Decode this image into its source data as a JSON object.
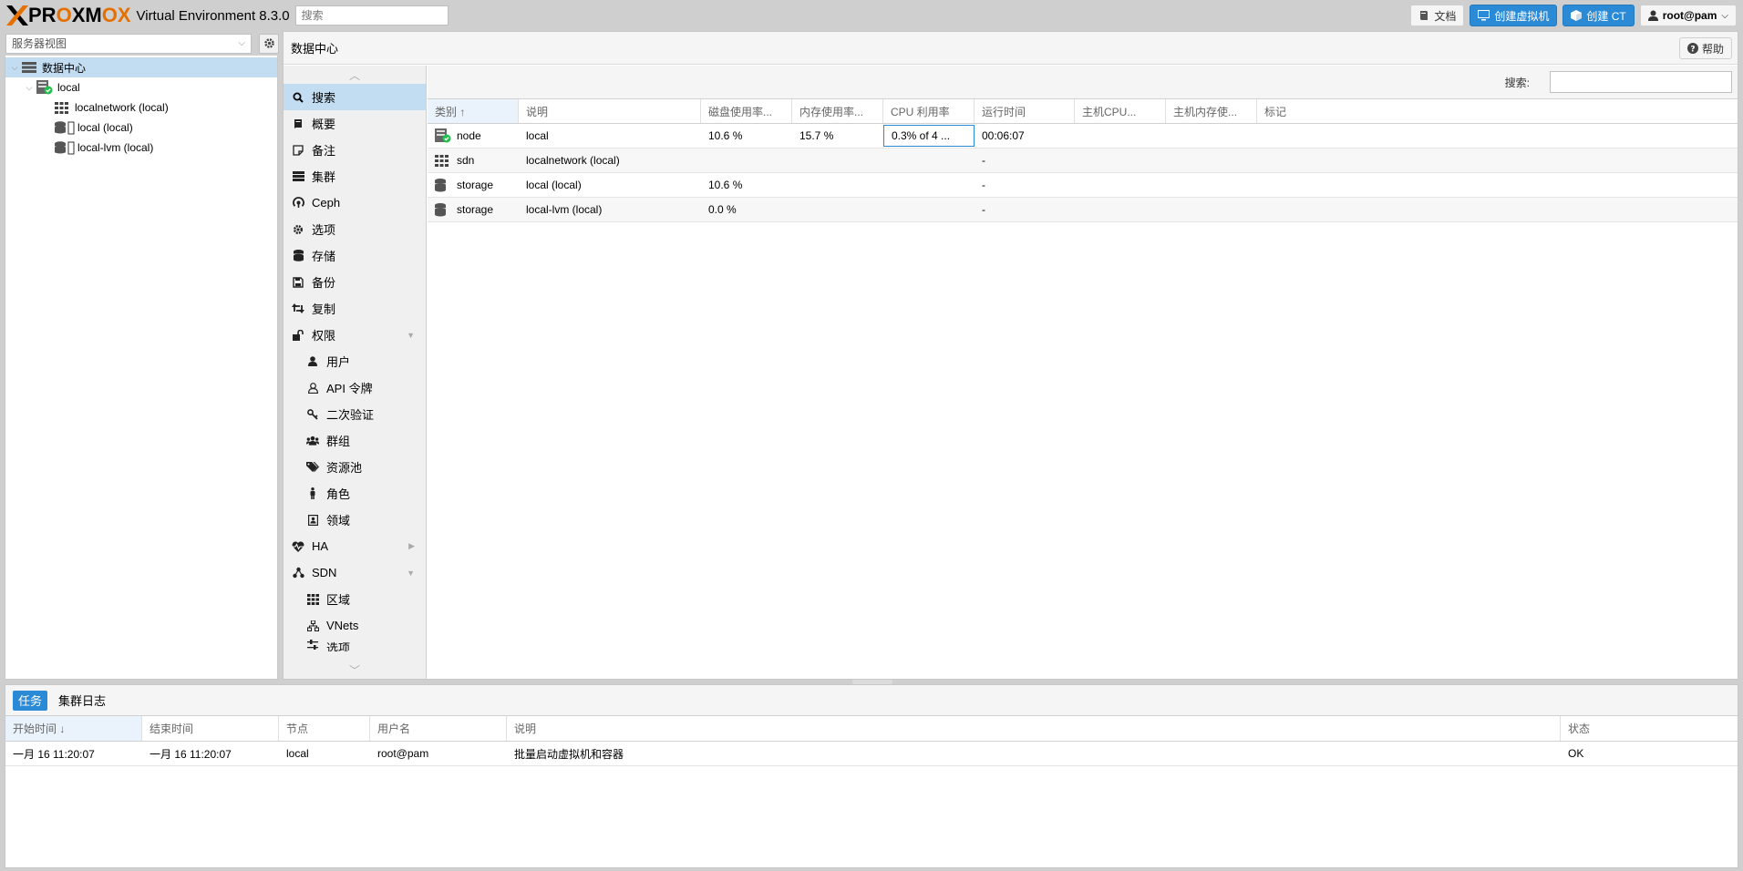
{
  "header": {
    "logo_text": "PROXMOX",
    "version": "Virtual Environment 8.3.0",
    "search_placeholder": "搜索",
    "buttons": {
      "docs": "文档",
      "create_vm": "创建虚拟机",
      "create_ct": "创建 CT",
      "user": "root@pam"
    }
  },
  "left": {
    "view_select": "服务器视图",
    "tree": [
      {
        "label": "数据中心",
        "icon": "datacenter-icon"
      },
      {
        "label": "local",
        "icon": "node-online-icon"
      },
      {
        "label": "localnetwork (local)",
        "icon": "sdn-grid-icon"
      },
      {
        "label": "local (local)",
        "icon": "storage-icon"
      },
      {
        "label": "local-lvm (local)",
        "icon": "storage-icon"
      }
    ]
  },
  "main": {
    "title": "数据中心",
    "help": "帮助",
    "nav": [
      {
        "label": "搜索",
        "icon": "search-icon"
      },
      {
        "label": "概要",
        "icon": "book-icon"
      },
      {
        "label": "备注",
        "icon": "note-icon"
      },
      {
        "label": "集群",
        "icon": "server-icon"
      },
      {
        "label": "Ceph",
        "icon": "ceph-icon"
      },
      {
        "label": "选项",
        "icon": "gear-icon"
      },
      {
        "label": "存储",
        "icon": "database-icon"
      },
      {
        "label": "备份",
        "icon": "floppy-icon"
      },
      {
        "label": "复制",
        "icon": "retweet-icon"
      },
      {
        "label": "权限",
        "icon": "unlock-icon"
      },
      {
        "label": "用户",
        "icon": "user-icon"
      },
      {
        "label": "API 令牌",
        "icon": "user-outline-icon"
      },
      {
        "label": "二次验证",
        "icon": "key-icon"
      },
      {
        "label": "群组",
        "icon": "users-icon"
      },
      {
        "label": "资源池",
        "icon": "tags-icon"
      },
      {
        "label": "角色",
        "icon": "male-icon"
      },
      {
        "label": "领域",
        "icon": "address-book-icon"
      },
      {
        "label": "HA",
        "icon": "heartbeat-icon"
      },
      {
        "label": "SDN",
        "icon": "sdn-icon"
      },
      {
        "label": "区域",
        "icon": "grid-icon"
      },
      {
        "label": "VNets",
        "icon": "sitemap-icon"
      },
      {
        "label": "选项",
        "icon": "sliders-icon"
      }
    ],
    "search_label": "搜索:",
    "columns": [
      "类别 ↑",
      "说明",
      "磁盘使用率...",
      "内存使用率...",
      "CPU 利用率",
      "运行时间",
      "主机CPU...",
      "主机内存使...",
      "标记"
    ],
    "rows": [
      {
        "type": "node",
        "desc": "local",
        "disk": "10.6 %",
        "mem": "15.7 %",
        "cpu": "0.3% of 4 ...",
        "uptime": "00:06:07",
        "icon": "node-online-icon"
      },
      {
        "type": "sdn",
        "desc": "localnetwork (local)",
        "disk": "",
        "mem": "",
        "cpu": "",
        "uptime": "-",
        "icon": "sdn-grid-icon"
      },
      {
        "type": "storage",
        "desc": "local (local)",
        "disk": "10.6 %",
        "mem": "",
        "cpu": "",
        "uptime": "-",
        "icon": "database-icon"
      },
      {
        "type": "storage",
        "desc": "local-lvm (local)",
        "disk": "0.0 %",
        "mem": "",
        "cpu": "",
        "uptime": "-",
        "icon": "database-icon"
      }
    ]
  },
  "bottom": {
    "tabs": [
      "任务",
      "集群日志"
    ],
    "columns": [
      "开始时间 ↓",
      "结束时间",
      "节点",
      "用户名",
      "说明",
      "状态"
    ],
    "rows": [
      {
        "start": "一月 16 11:20:07",
        "end": "一月 16 11:20:07",
        "node": "local",
        "user": "root@pam",
        "desc": "批量启动虚拟机和容器",
        "status": "OK"
      }
    ]
  },
  "colors": {
    "accent": "#2b8ad6",
    "selected": "#c2ddf2",
    "logo_orange": "#e57000"
  }
}
